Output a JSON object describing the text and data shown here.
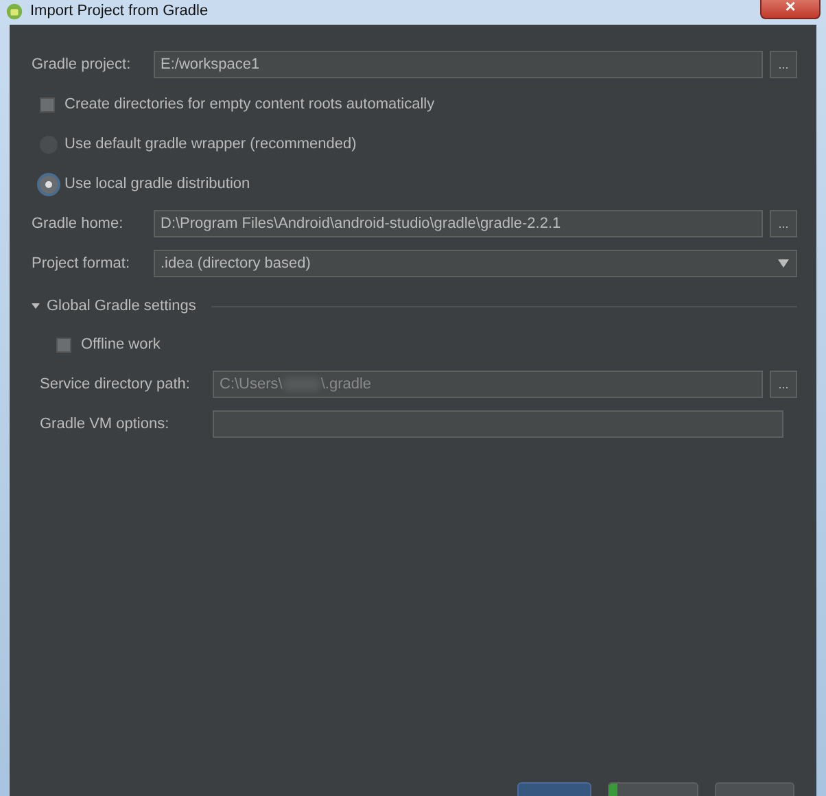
{
  "window": {
    "title": "Import Project from Gradle",
    "close": "×"
  },
  "gradle_project": {
    "label": "Gradle project:",
    "value": "E:/workspace1",
    "browse": "..."
  },
  "create_dirs": {
    "label": "Create directories for empty content roots automatically",
    "checked": false
  },
  "distribution": [
    {
      "label": "Use default gradle wrapper (recommended)",
      "selected": false,
      "disabled": true
    },
    {
      "label": "Use local gradle distribution",
      "selected": true,
      "disabled": false
    }
  ],
  "gradle_home": {
    "label": "Gradle home:",
    "value": "D:\\Program Files\\Android\\android-studio\\gradle\\gradle-2.2.1",
    "browse": "..."
  },
  "project_format": {
    "label": "Project format:",
    "value": ".idea (directory based)"
  },
  "global_settings": {
    "title": "Global Gradle settings",
    "expanded": true,
    "offline": {
      "label": "Offline work",
      "checked": false
    },
    "service_dir": {
      "label": "Service directory path:",
      "value_start": "C:\\Users\\",
      "value_end": "\\.gradle",
      "browse": "...",
      "disabled": true
    },
    "vm_options": {
      "label": "Gradle VM options:"
    }
  },
  "buttons": [
    {
      "kind": "primary"
    },
    {
      "kind": "green"
    },
    {
      "kind": "plain"
    }
  ]
}
